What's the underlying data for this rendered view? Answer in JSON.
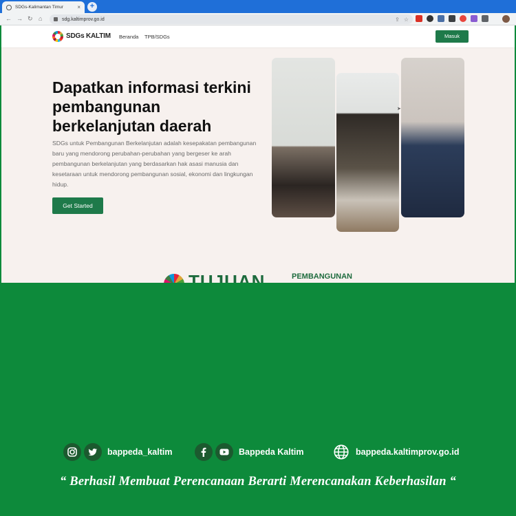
{
  "browser": {
    "tab_title": "SDGs-Kalimantan Timur",
    "tab_close": "×",
    "new_tab": "+",
    "url": "sdg.kaltimprov.go.id"
  },
  "site": {
    "brand": "SDGs KALTIM",
    "menu": [
      "Beranda",
      "TPB/SDGs"
    ],
    "login_label": "Masuk",
    "hero_title": "Dapatkan informasi terkini pembangunan berkelanjutan daerah",
    "hero_description": "SDGs untuk Pembangunan Berkelanjutan adalah kesepakatan pembangunan baru yang mendorong perubahan-perubahan yang bergeser ke arah pembangunan berkelanjutan yang berdasarkan hak asasi manusia dan kesetaraan untuk mendorong pembangunan sosial, ekonomi dan lingkungan hidup.",
    "cta_label": "Get Started",
    "banner_big": "TUJUAN",
    "banner_small": "PEMBANGUNAN"
  },
  "footer": {
    "social_handle_1": "bappeda_kaltim",
    "social_handle_2": "Bappeda Kaltim",
    "website": "bappeda.kaltimprov.go.id",
    "quote": "“ Berhasil  Membuat Perencanaan Berarti Merencanakan Keberhasilan “"
  },
  "colors": {
    "footer_green": "#0d8a3b",
    "button_green": "#1e7a4a",
    "browser_blue": "#1f6fd8"
  },
  "icons": [
    "instagram-icon",
    "twitter-icon",
    "facebook-icon",
    "youtube-icon",
    "globe-icon"
  ]
}
